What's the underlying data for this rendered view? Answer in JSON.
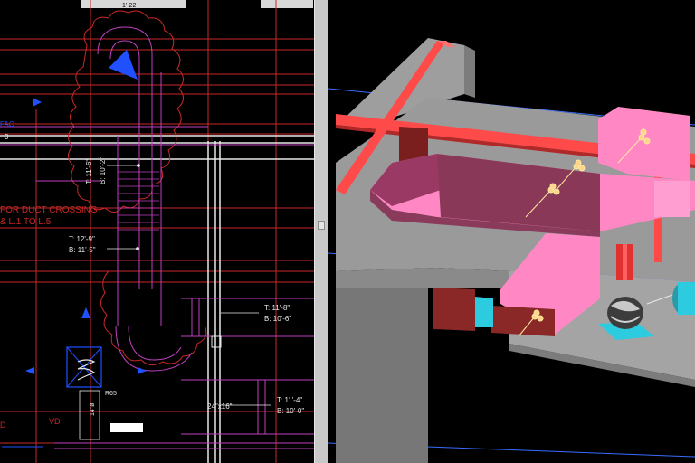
{
  "cad": {
    "title_tab": "1'-22",
    "left_mark_1": "FAC",
    "left_mark_2": "0",
    "note_line_1": "FOR DUCT CROSSING",
    "note_line_2": "& L.1 TO L.5",
    "tag1_top": "T:  11'-6\"",
    "tag1_bot": "B:  10'-2\"",
    "tag2_top": "T:  12'-9\"",
    "tag2_bot": "B:  11'-5\"",
    "tag3_top": "T:  11'-8\"",
    "tag3_bot": "B:  10'-6\"",
    "tag4_top": "T:  11'-4\"",
    "tag4_bot": "B:  10'-0\"",
    "duct_size": "24\"x16\"",
    "label_r": "R65",
    "label_d": "14\"ø",
    "label_vd": "VD",
    "label_d2": "D"
  },
  "colors": {
    "cad_red": "#c82828",
    "cad_magenta": "#c040c0",
    "cad_white": "#e8e8e8",
    "cad_blue": "#2050ff",
    "duct_pink": "#ff88c4",
    "beam_red": "#ff4a4a",
    "slab_gray": "#9e9e9e",
    "accent_cyan": "#2ccbe0"
  },
  "icons": {
    "splitter_grip": "grip-icon",
    "flow_arrow": "arrow-icon",
    "diffuser": "diffuser-icon",
    "fan": "fan-icon"
  }
}
